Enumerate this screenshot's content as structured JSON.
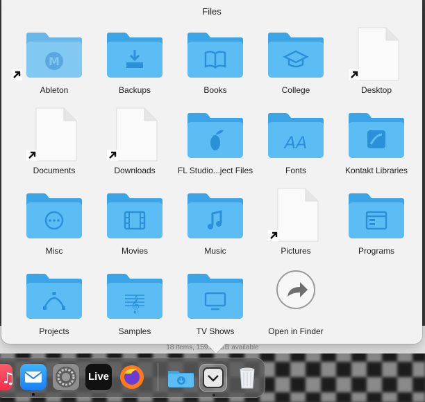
{
  "stack": {
    "title": "Files",
    "items": [
      {
        "label": "Ableton",
        "kind": "folder",
        "icon": "ableton-logo",
        "alias": true
      },
      {
        "label": "Backups",
        "kind": "folder",
        "icon": "download-tray"
      },
      {
        "label": "Books",
        "kind": "folder",
        "icon": "open-book"
      },
      {
        "label": "College",
        "kind": "folder",
        "icon": "graduation-cap"
      },
      {
        "label": "Desktop",
        "kind": "document",
        "alias": true
      },
      {
        "label": "Documents",
        "kind": "document",
        "alias": true
      },
      {
        "label": "Downloads",
        "kind": "document",
        "alias": true
      },
      {
        "label": "FL Studio...ject Files",
        "kind": "folder",
        "icon": "fruit"
      },
      {
        "label": "Fonts",
        "kind": "folder",
        "icon": "font-aa"
      },
      {
        "label": "Kontakt Libraries",
        "kind": "folder",
        "icon": "kontakt-logo"
      },
      {
        "label": "Misc",
        "kind": "folder",
        "icon": "ellipsis-circle"
      },
      {
        "label": "Movies",
        "kind": "folder",
        "icon": "film-strip"
      },
      {
        "label": "Music",
        "kind": "folder",
        "icon": "music-note"
      },
      {
        "label": "Pictures",
        "kind": "document",
        "alias": true
      },
      {
        "label": "Programs",
        "kind": "folder",
        "icon": "app-window"
      },
      {
        "label": "Projects",
        "kind": "folder",
        "icon": "bezier-curve"
      },
      {
        "label": "Samples",
        "kind": "folder",
        "icon": "sheet-music"
      },
      {
        "label": "TV Shows",
        "kind": "folder",
        "icon": "tv-screen"
      },
      {
        "label": "Open in Finder",
        "kind": "action",
        "icon": "arrow-circle"
      }
    ]
  },
  "behind": {
    "status_text": "18 items, 159.07 GB available"
  },
  "dock": {
    "items": [
      "music-app-icon",
      "mail-app-icon",
      "system-preferences-icon",
      "live-app-icon",
      "firefox-app-icon",
      "downloads-stack-icon",
      "files-stack-icon",
      "trash-icon"
    ],
    "live_label": "Live"
  },
  "colors": {
    "folder_front": "#5cbcf4",
    "folder_back": "#3ba4e6",
    "folder_glyph": "#2b90d6",
    "stack_bg": "#f2f2f2"
  }
}
